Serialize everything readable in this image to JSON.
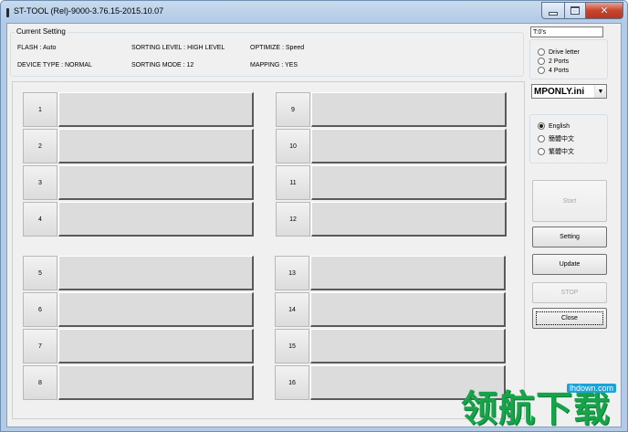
{
  "window": {
    "title": "ST-TOOL (Rel)-9000-3.76.15-2015.10.07",
    "close_glyph": "✕"
  },
  "current_setting": {
    "title": "Current Setting",
    "flash": "FLASH : Auto",
    "sorting_level": "SORTING LEVEL : HIGH LEVEL",
    "optimize": "OPTIMIZE : Speed",
    "device_type": "DEVICE TYPE : NORMAL",
    "sorting_mode": "SORTING MODE : 12",
    "mapping": "MAPPING : YES"
  },
  "timer": "T:0's",
  "port_options": [
    {
      "label": "Drive letter",
      "checked": false
    },
    {
      "label": "2 Ports",
      "checked": false
    },
    {
      "label": "4 Ports",
      "checked": false
    }
  ],
  "ini_select": {
    "value": "MPONLY.ini",
    "arrow": "▼"
  },
  "language_options": [
    {
      "label": "English",
      "checked": true
    },
    {
      "label": "簡體中文",
      "checked": false
    },
    {
      "label": "繁體中文",
      "checked": false
    }
  ],
  "buttons": {
    "start": "Start",
    "setting": "Setting",
    "update": "Update",
    "stop": "STOP",
    "close": "Close"
  },
  "slots": [
    "1",
    "2",
    "3",
    "4",
    "5",
    "6",
    "7",
    "8",
    "9",
    "10",
    "11",
    "12",
    "13",
    "14",
    "15",
    "16"
  ],
  "watermark": {
    "text": "领航下载",
    "url": "lhdown.com"
  }
}
